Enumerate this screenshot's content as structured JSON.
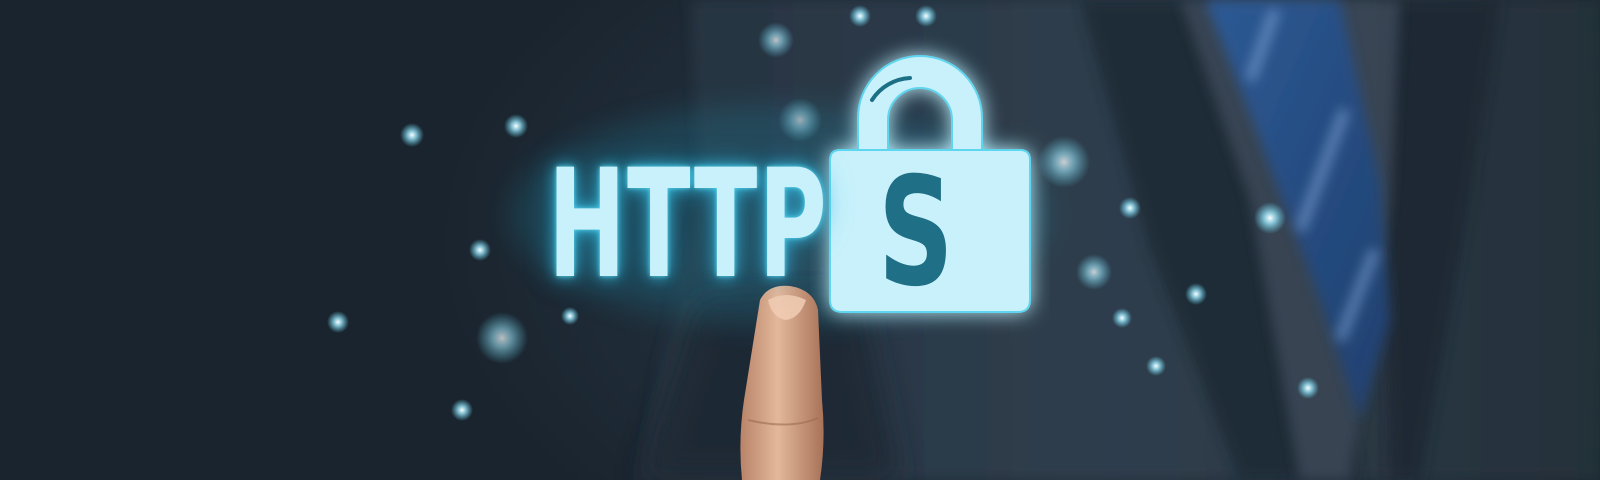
{
  "image": {
    "headline": "HTTPS",
    "lock_letter": "S",
    "icons": {
      "padlock": "padlock-icon",
      "pointing_finger": "pointing-finger"
    },
    "colors": {
      "background": "#1f2b36",
      "glow": "#5fd6f0",
      "text": "#c8f1fb",
      "suit": "#2a3744",
      "tie": "#3d6fb3"
    }
  }
}
